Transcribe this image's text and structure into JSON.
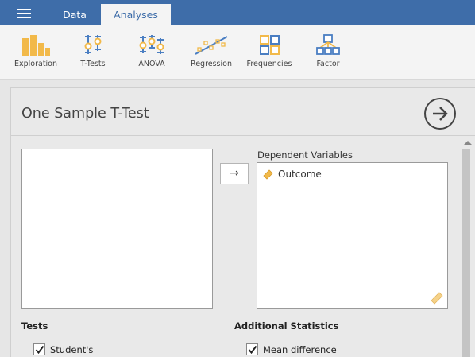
{
  "tabs": [
    {
      "label": "Data"
    },
    {
      "label": "Analyses"
    }
  ],
  "ribbon": [
    {
      "label": "Exploration",
      "icon": "exploration-icon"
    },
    {
      "label": "T-Tests",
      "icon": "t-tests-icon"
    },
    {
      "label": "ANOVA",
      "icon": "anova-icon"
    },
    {
      "label": "Regression",
      "icon": "regression-icon"
    },
    {
      "label": "Frequencies",
      "icon": "frequencies-icon"
    },
    {
      "label": "Factor",
      "icon": "factor-icon"
    }
  ],
  "panel": {
    "title": "One Sample T-Test",
    "move_arrow": "→",
    "dependent_label": "Dependent Variables",
    "dependent_items": [
      {
        "name": "Outcome",
        "icon": "continuous-variable-icon"
      }
    ],
    "tests_header": "Tests",
    "additional_header": "Additional Statistics",
    "tests": [
      {
        "label": "Student's",
        "checked": true
      }
    ],
    "additional": [
      {
        "label": "Mean difference",
        "checked": true
      }
    ]
  },
  "colors": {
    "accent": "#3e6da9",
    "ribbon_icon_orange": "#f2b949",
    "ribbon_icon_blue": "#4a7ec2"
  }
}
